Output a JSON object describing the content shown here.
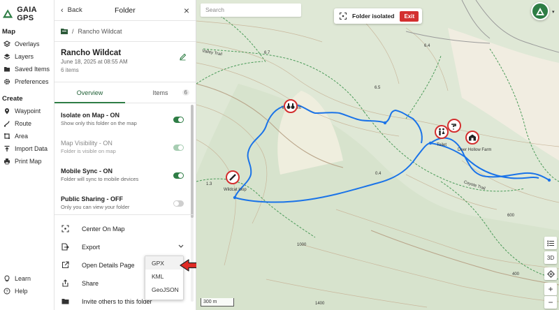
{
  "app": {
    "brand": "GAIA GPS",
    "accent_color": "#2e7d45",
    "brand_color": "#2e7d45"
  },
  "nav": {
    "map_section": "Map",
    "map_items": [
      {
        "label": "Overlays",
        "icon": "overlays-icon"
      },
      {
        "label": "Layers",
        "icon": "layers-icon"
      },
      {
        "label": "Saved Items",
        "icon": "saved-items-icon"
      },
      {
        "label": "Preferences",
        "icon": "gear-icon"
      }
    ],
    "create_section": "Create",
    "create_items": [
      {
        "label": "Waypoint",
        "icon": "waypoint-icon"
      },
      {
        "label": "Route",
        "icon": "route-icon"
      },
      {
        "label": "Area",
        "icon": "area-icon"
      },
      {
        "label": "Import Data",
        "icon": "import-icon"
      },
      {
        "label": "Print Map",
        "icon": "print-icon"
      }
    ],
    "bottom_items": [
      {
        "label": "Learn",
        "icon": "lightbulb-icon"
      },
      {
        "label": "Help",
        "icon": "help-icon"
      }
    ]
  },
  "panel": {
    "back_label": "Back",
    "title": "Folder",
    "breadcrumb_separator": "/",
    "breadcrumb": "Rancho Wildcat",
    "folder_name": "Rancho Wildcat",
    "folder_date": "June 18, 2025 at 08:55 AM",
    "item_count": "6 items",
    "tabs": [
      {
        "label": "Overview"
      },
      {
        "label": "Items"
      }
    ],
    "items_count_badge": "6",
    "settings": [
      {
        "title": "Isolate on Map - ON",
        "desc": "Show only this folder on the map",
        "state": "on"
      },
      {
        "title": "Map Visibility - ON",
        "desc": "Folder is visible on map",
        "state": "on-disabled"
      },
      {
        "title": "Mobile Sync - ON",
        "desc": "Folder will sync to mobile devices",
        "state": "on"
      },
      {
        "title": "Public Sharing - OFF",
        "desc": "Only you can view your folder",
        "state": "off"
      }
    ],
    "actions": {
      "center": "Center On Map",
      "export": "Export",
      "details": "Open Details Page",
      "share": "Share",
      "invite": "Invite others to this folder"
    },
    "export_options": [
      "GPX",
      "KML",
      "GeoJSON"
    ]
  },
  "map": {
    "search_placeholder": "Search",
    "isolated_label": "Folder isolated",
    "exit_label": "Exit",
    "scale": "300 m",
    "mode_3d": "3D",
    "zoom_in": "+",
    "zoom_out": "−",
    "trail_color": "#1a73e8",
    "marker_color": "#d32f2f",
    "labels": {
      "valley_trail": "Valley Trail",
      "vista_point": "Vista point",
      "toilet": "Toilet",
      "deer_hollow": "Deer Hollow Farm",
      "coyote_trail": "Coyote Trail",
      "wildcat_loop": "Wildcat loop",
      "c64": "6.4",
      "c67": "6.7",
      "c65": "6.5",
      "c13": "1.3",
      "c04": "0.4",
      "c600": "600",
      "c1000": "1000",
      "c1400": "1400",
      "c400": "400"
    }
  }
}
